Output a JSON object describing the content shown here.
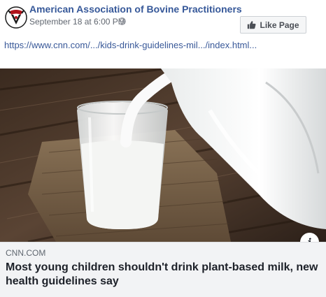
{
  "post": {
    "page_name": "American Association of Bovine Practitioners",
    "timestamp": "September 18 at 6:00 PM",
    "like_button_label": "Like Page",
    "link_url": "https://www.cnn.com/.../kids-drink-guidelines-mil.../index.html..."
  },
  "link_preview": {
    "source": "CNN.COM",
    "headline": "Most young children shouldn't drink plant-based milk, new health guidelines say",
    "info_icon": "i"
  },
  "icons": {
    "avatar": "bovine-practitioners-logo",
    "globe": "globe-icon",
    "like": "thumbs-up-icon",
    "info": "info-icon"
  },
  "colors": {
    "page_name": "#365899",
    "link": "#385898",
    "caption_bg": "#f2f3f5"
  }
}
